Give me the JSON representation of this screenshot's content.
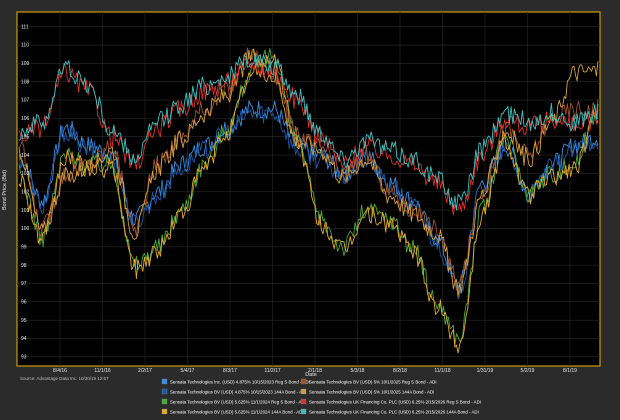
{
  "chart_data": {
    "type": "line",
    "xlabel": "Date",
    "ylabel": "Bond Price (Bid)",
    "source": "Source: Advantage Data Inc. 10/30/19 12:57",
    "x_ticks": [
      "8/4/16",
      "11/1/16",
      "2/2/17",
      "5/4/17",
      "8/3/17",
      "11/2/17",
      "2/1/18",
      "5/3/18",
      "8/2/18",
      "11/1/18",
      "1/31/19",
      "5/2/19",
      "8/1/19"
    ],
    "y_ticks": [
      93,
      94,
      95,
      96,
      97,
      98,
      99,
      100,
      101,
      102,
      103,
      104,
      105,
      106,
      107,
      108,
      109,
      110,
      111
    ],
    "ylim": [
      92.5,
      111.8
    ],
    "grid": true,
    "legend_position": "bottom",
    "series": [
      {
        "name": "Sensata Technologies Inc. (USD) 4.875% 10/15/2023 Reg S Bond - ADI",
        "color": "#3a8fe0",
        "values": [
          104,
          101.5,
          105.5,
          104.5,
          104,
          100.5,
          102,
          103.5,
          104.5,
          105.5,
          106.5,
          106.5,
          104.5,
          104,
          103,
          104,
          102.5,
          101.5,
          99.5,
          96.8,
          102.5,
          104.5,
          102,
          103.5,
          104.5,
          105
        ]
      },
      {
        "name": "Sensata Technologies BV (USD) 4.875% 10/15/2023 144A Bond - ADI",
        "color": "#1e5aa8",
        "values": [
          103.8,
          101.2,
          105.3,
          104.3,
          103.8,
          100.3,
          101.8,
          103.3,
          104.3,
          105.3,
          106.3,
          106.3,
          104.3,
          103.8,
          102.8,
          103.8,
          102.3,
          101.3,
          99.3,
          96.6,
          102.3,
          104.3,
          101.8,
          103.3,
          104.3,
          104.8
        ]
      },
      {
        "name": "Sensata Technologies BV (USD) 5.625% 11/1/2024 Reg S Bond - ADI",
        "color": "#4aa83c",
        "values": [
          103,
          99.5,
          104,
          103.5,
          103.5,
          98,
          99,
          101,
          103.5,
          105.5,
          108.5,
          109.5,
          105,
          100.5,
          99,
          101,
          100.5,
          99,
          96,
          94,
          101,
          105,
          102,
          103,
          103.5,
          106.5
        ]
      },
      {
        "name": "Sensata Technologies BV (USD) 5.625% 11/1/2024 144A Bond - ADI",
        "color": "#e6a82a",
        "values": [
          102.8,
          99.3,
          103.8,
          103.3,
          103.3,
          97.8,
          98.8,
          100.8,
          103.3,
          105.3,
          108.3,
          109.3,
          104.8,
          100.3,
          98.8,
          100.8,
          100.3,
          98.8,
          95.8,
          93.7,
          100.8,
          104.8,
          101.8,
          102.8,
          103.3,
          106.3
        ]
      },
      {
        "name": "Sensata Technologies BV (USD) 5% 10/1/2025 Reg S Bond - ADI",
        "color": "#a0522d",
        "values": [
          104.5,
          100,
          103,
          103.5,
          104.5,
          100,
          103.5,
          105,
          106.5,
          107.5,
          109.5,
          108.5,
          105,
          104.5,
          103,
          104,
          102,
          101,
          100,
          97,
          102,
          105.5,
          104,
          106,
          106.5,
          106.5
        ]
      },
      {
        "name": "Sensata Technologies BV (USD) 5% 10/1/2025 144A Bond - ADI",
        "color": "#d4a03c",
        "values": [
          104.3,
          99.8,
          102.8,
          103.3,
          104.3,
          99.8,
          103.3,
          104.8,
          106.3,
          107.3,
          109.3,
          108.3,
          104.8,
          104.3,
          102.8,
          103.8,
          101.8,
          100.8,
          99.8,
          96.8,
          101.8,
          105.3,
          103.8,
          105.8,
          108.5,
          108.6
        ]
      },
      {
        "name": "Sensata Technologies UK Financing Co. PLC (USD) 6.25% 2/15/2026 Reg S Bond - ADI",
        "color": "#e0302a",
        "values": [
          105,
          105.5,
          108.5,
          107.5,
          105,
          103.5,
          105.5,
          106.5,
          107.5,
          108,
          109,
          108.5,
          107,
          105,
          103.5,
          104.5,
          104,
          103.5,
          102.5,
          101,
          104,
          106,
          105.5,
          106,
          105.5,
          106
        ]
      },
      {
        "name": "Sensata Technologies UK Financing Co. PLC (USD) 6.25% 2/15/2026 144A Bond - ADI",
        "color": "#3cc0c0",
        "values": [
          105.3,
          105.8,
          108.8,
          107.8,
          105.3,
          103.8,
          105.8,
          106.8,
          107.8,
          108.3,
          109.3,
          108.8,
          107.3,
          105.3,
          103.8,
          104.8,
          104.3,
          103.8,
          102.8,
          101.3,
          104.3,
          106.3,
          105.8,
          106.3,
          105.8,
          106.3
        ]
      }
    ]
  }
}
